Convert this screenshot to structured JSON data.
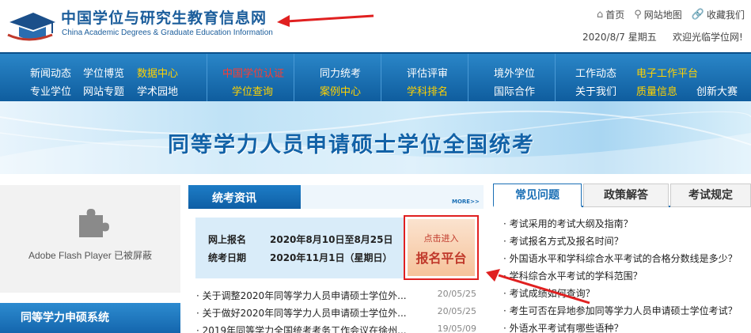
{
  "header": {
    "title": "中国学位与研究生教育信息网",
    "subtitle": "China Academic Degrees & Graduate Education Information",
    "top_links": [
      {
        "icon": "home-icon",
        "label": "首页"
      },
      {
        "icon": "map-pin-icon",
        "label": "网站地图"
      },
      {
        "icon": "paperclip-icon",
        "label": "收藏我们"
      }
    ],
    "date": "2020/8/7 星期五",
    "welcome": "欢迎光临学位网!"
  },
  "nav": {
    "row1": [
      "新闻动态",
      "学位博览",
      "数据中心",
      "中国学位认证",
      "同力统考",
      "评估评审",
      "境外学位",
      "工作动态",
      "电子工作平台"
    ],
    "row2": [
      "专业学位",
      "网站专题",
      "学术园地",
      "学位查询",
      "案例中心",
      "学科排名",
      "国际合作",
      "关于我们",
      "质量信息",
      "创新大赛"
    ]
  },
  "banner": {
    "text": "同等学力人员申请硕士学位全国统考"
  },
  "left": {
    "flash_text": "Adobe Flash Player 已被屏蔽",
    "system_title": "同等学力申硕系统"
  },
  "middle": {
    "title": "统考资讯",
    "more": "MORE>>",
    "exam": {
      "reg_label": "网上报名",
      "reg_value": "2020年8月10日至8月25日",
      "date_label": "统考日期",
      "date_value": "2020年11月1日（星期日）"
    },
    "enter": {
      "sub": "点击进入",
      "main": "报名平台"
    },
    "news": [
      {
        "title": "· 关于调整2020年同等学力人员申请硕士学位外...",
        "date": "20/05/25"
      },
      {
        "title": "· 关于做好2020年同等学力人员申请硕士学位外...",
        "date": "20/05/25"
      },
      {
        "title": "· 2019年同等学力全国统考考务工作会议在徐州...",
        "date": "19/05/09"
      }
    ]
  },
  "right": {
    "tabs": [
      "常见问题",
      "政策解答",
      "考试规定"
    ],
    "faq": [
      "· 考试采用的考试大纲及指南？",
      "· 考试报名方式及报名时间？",
      "· 外国语水平和学科综合水平考试的合格分数线是多少？",
      "· 学科综合水平考试的学科范围？",
      "· 考试成绩如何查询？",
      "· 考生可否在异地参加同等学力人员申请硕士学位考试？",
      "· 外语水平考试有哪些语种？"
    ]
  },
  "colors": {
    "brand": "#1b5d9b",
    "nav": "#1466ad",
    "highlight": "#ffd200",
    "accent_red": "#e02020"
  }
}
